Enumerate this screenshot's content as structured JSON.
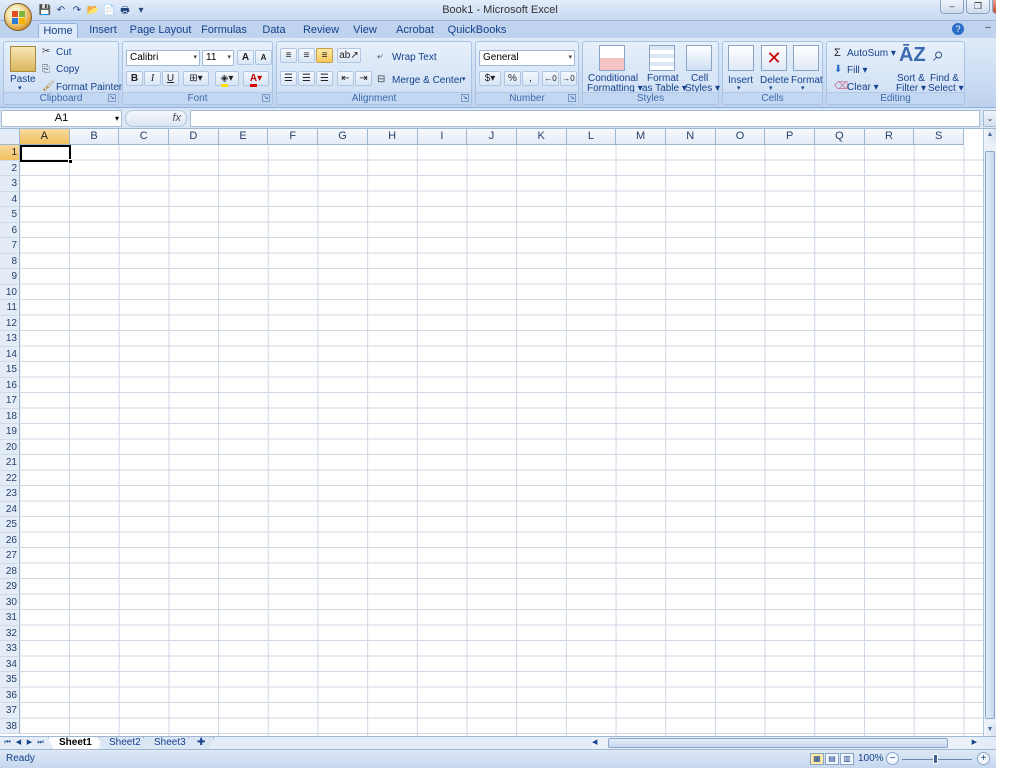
{
  "window": {
    "title": "Book1 - Microsoft Excel",
    "minimize": "–",
    "restore": "❐",
    "close": "✕"
  },
  "quick_access": [
    {
      "icon": "save-icon",
      "glyph": "💾"
    },
    {
      "icon": "undo-icon",
      "glyph": "↶"
    },
    {
      "icon": "redo-icon",
      "glyph": "↷"
    },
    {
      "icon": "open-icon",
      "glyph": "📂"
    },
    {
      "icon": "new-icon",
      "glyph": "📄"
    },
    {
      "icon": "print-preview-icon",
      "glyph": "🖶"
    },
    {
      "icon": "qat-customize-icon",
      "glyph": "▾"
    }
  ],
  "tabs": [
    {
      "label": "Home",
      "active": true
    },
    {
      "label": "Insert"
    },
    {
      "label": "Page Layout"
    },
    {
      "label": "Formulas"
    },
    {
      "label": "Data"
    },
    {
      "label": "Review"
    },
    {
      "label": "View"
    },
    {
      "label": "Acrobat"
    },
    {
      "label": "QuickBooks"
    }
  ],
  "ribbon": {
    "clipboard": {
      "label": "Clipboard",
      "paste": "Paste",
      "cut": "Cut",
      "copy": "Copy",
      "format_painter": "Format Painter"
    },
    "font": {
      "label": "Font",
      "name": "Calibri",
      "size": "11",
      "grow": "A",
      "shrink": "A",
      "bold": "B",
      "italic": "I",
      "underline": "U"
    },
    "alignment": {
      "label": "Alignment",
      "wrap_text": "Wrap Text",
      "merge_center": "Merge & Center"
    },
    "number": {
      "label": "Number",
      "format": "General",
      "currency": "$",
      "percent": "%",
      "comma": ","
    },
    "styles": {
      "label": "Styles",
      "conditional_1": "Conditional",
      "conditional_2": "Formatting",
      "table_1": "Format",
      "table_2": "as Table",
      "cell_1": "Cell",
      "cell_2": "Styles"
    },
    "cells": {
      "label": "Cells",
      "insert": "Insert",
      "delete": "Delete",
      "format": "Format"
    },
    "editing": {
      "label": "Editing",
      "autosum": "AutoSum",
      "fill": "Fill",
      "clear": "Clear",
      "sort_1": "Sort &",
      "sort_2": "Filter",
      "find_1": "Find &",
      "find_2": "Select"
    }
  },
  "formula_bar": {
    "name_box": "A1",
    "fx": "fx",
    "formula": ""
  },
  "columns": [
    "A",
    "B",
    "C",
    "D",
    "E",
    "F",
    "G",
    "H",
    "I",
    "J",
    "K",
    "L",
    "M",
    "N",
    "O",
    "P",
    "Q",
    "R",
    "S"
  ],
  "rows": [
    "1",
    "2",
    "3",
    "4",
    "5",
    "6",
    "7",
    "8",
    "9",
    "10",
    "11",
    "12",
    "13",
    "14",
    "15",
    "16",
    "17",
    "18",
    "19",
    "20",
    "21",
    "22",
    "23",
    "24",
    "25",
    "26",
    "27",
    "28",
    "29",
    "30",
    "31",
    "32",
    "33",
    "34",
    "35",
    "36",
    "37",
    "38"
  ],
  "active_cell": "A1",
  "sheets": [
    {
      "label": "Sheet1",
      "active": true
    },
    {
      "label": "Sheet2"
    },
    {
      "label": "Sheet3"
    }
  ],
  "status": {
    "text": "Ready",
    "zoom": "100%"
  },
  "colors": {
    "accent": "#15428b",
    "selected_header": "#f1c15f",
    "gridline": "#d0d7e5"
  }
}
